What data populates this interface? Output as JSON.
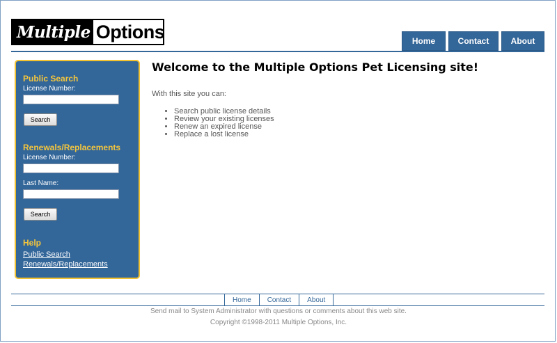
{
  "logo": {
    "part1": "Multiple",
    "part2": "Options"
  },
  "topnav": [
    "Home",
    "Contact",
    "About"
  ],
  "sidebar": {
    "public_search": {
      "heading": "Public Search",
      "license_label": "License Number:",
      "license_value": "",
      "button": "Search"
    },
    "renewals": {
      "heading": "Renewals/Replacements",
      "license_label": "License Number:",
      "license_value": "",
      "lastname_label": "Last Name:",
      "lastname_value": "",
      "button": "Search"
    },
    "help": {
      "heading": "Help",
      "links": [
        "Public Search",
        "Renewals/Replacements"
      ]
    }
  },
  "main": {
    "title": "Welcome to the Multiple Options Pet Licensing site!",
    "intro": "With this site you can:",
    "features": [
      "Search public license details",
      "Review your existing licenses",
      "Renew an expired license",
      "Replace a lost license"
    ]
  },
  "footer": {
    "nav": [
      "Home",
      "Contact",
      "About"
    ],
    "mail_text": "Send mail to System Administrator with questions or comments about this web site.",
    "copyright": "Copyright ©1998-2011 Multiple Options, Inc."
  },
  "colors": {
    "brand": "#336699",
    "accent": "#f5c63c",
    "text_muted": "#555555"
  }
}
